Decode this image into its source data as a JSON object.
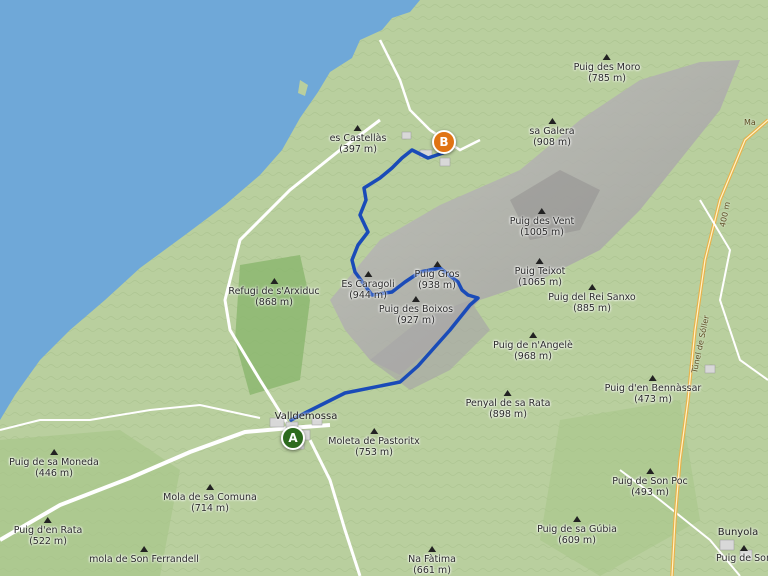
{
  "map": {
    "colors": {
      "sea": "#6fa8d8",
      "land": "#b9cf9e",
      "ridge": "#a9a7a8",
      "forest": "#8cb770",
      "route": "#1a4bb8",
      "start_marker": "#2e6b1e",
      "end_marker": "#e07414"
    },
    "markers": [
      {
        "id": "start",
        "label": "A"
      },
      {
        "id": "end",
        "label": "B"
      }
    ],
    "peaks": [
      {
        "name": "Puig des Moro",
        "elev": "(785 m)"
      },
      {
        "name": "sa Galera",
        "elev": "(908 m)"
      },
      {
        "name": "es Castellàs",
        "elev": "(397 m)"
      },
      {
        "name": "Puig des Vent",
        "elev": "(1005 m)"
      },
      {
        "name": "Puig Teixot",
        "elev": "(1065 m)"
      },
      {
        "name": "Puig Gros",
        "elev": "(938 m)"
      },
      {
        "name": "Es Caragoli",
        "elev": "(944 m)"
      },
      {
        "name": "Refugi de s'Arxiduc",
        "elev": "(868 m)"
      },
      {
        "name": "Puig des Boixos",
        "elev": "(927 m)"
      },
      {
        "name": "Puig del Rei Sanxo",
        "elev": "(885 m)"
      },
      {
        "name": "Puig de n'Angelè",
        "elev": "(968 m)"
      },
      {
        "name": "Puig d'en Bennàssar",
        "elev": "(473 m)"
      },
      {
        "name": "Penyal de sa Rata",
        "elev": "(898 m)"
      },
      {
        "name": "Moleta de Pastoritx",
        "elev": "(753 m)"
      },
      {
        "name": "Puig de sa Moneda",
        "elev": "(446 m)"
      },
      {
        "name": "Mola de sa Comuna",
        "elev": "(714 m)"
      },
      {
        "name": "Puig d'en Rata",
        "elev": "(522 m)"
      },
      {
        "name": "mola de Son Ferrandell",
        "elev": ""
      },
      {
        "name": "Puig de Son Poc",
        "elev": "(493 m)"
      },
      {
        "name": "Puig de sa Gúbia",
        "elev": "(609 m)"
      },
      {
        "name": "Na Fàtima",
        "elev": "(661 m)"
      },
      {
        "name": "Puig de Son",
        "elev": ""
      }
    ],
    "towns": [
      {
        "name": "Valldemossa"
      },
      {
        "name": "Bunyola"
      }
    ],
    "road_labels": [
      {
        "text": "Túnel de Sóller"
      },
      {
        "text": "400 m"
      },
      {
        "text": "Ma"
      }
    ]
  }
}
